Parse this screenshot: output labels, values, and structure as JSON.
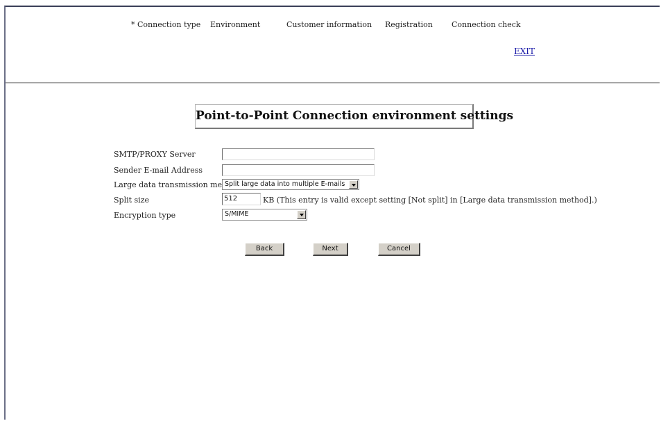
{
  "nav": {
    "steps": [
      "* Connection type",
      "Environment",
      "Customer information",
      "Registration",
      "Connection check"
    ],
    "exit_label": "EXIT"
  },
  "page_title": "Point-to-Point Connection environment settings",
  "form": {
    "smtp_label": "SMTP/PROXY Server",
    "smtp_value": "",
    "sender_label": "Sender E-mail Address",
    "sender_value": "",
    "large_data_label": "Large data transmission method",
    "large_data_selected": "Split large data into multiple E-mails",
    "split_size_label": "Split size",
    "split_size_value": "512",
    "split_size_note": "KB (This entry is valid except setting [Not split] in [Large data transmission method].)",
    "encryption_label": "Encryption type",
    "encryption_selected": "S/MIME"
  },
  "buttons": {
    "back": "Back",
    "next": "Next",
    "cancel": "Cancel"
  },
  "colors": {
    "link": "#1a1aa8",
    "button_face": "#d4d0c8",
    "frame_border": "#3a3f58"
  }
}
